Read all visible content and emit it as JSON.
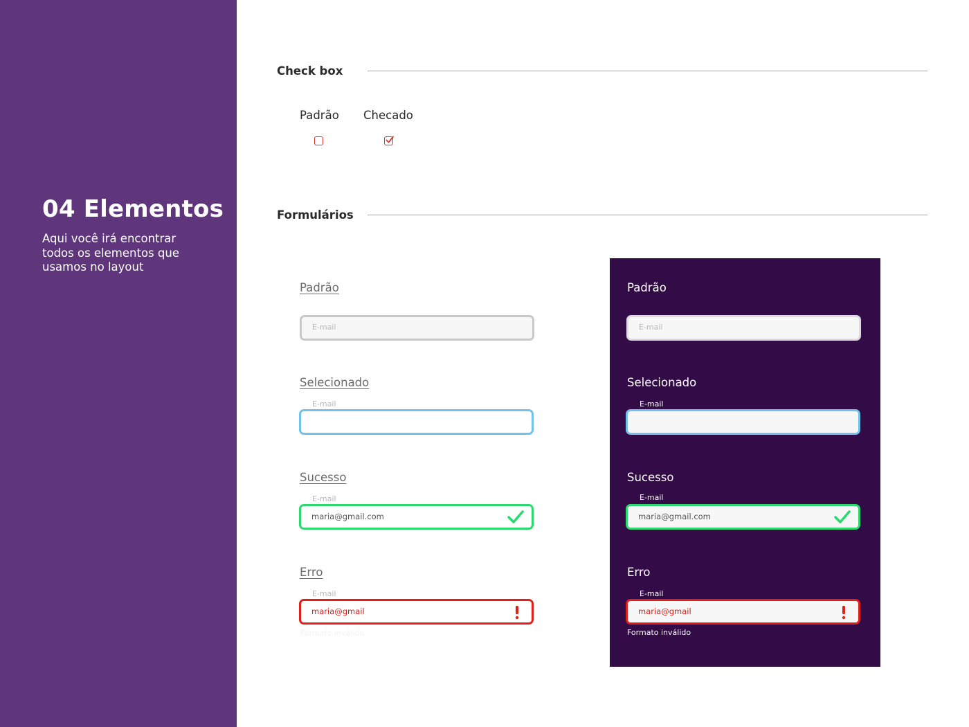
{
  "sidebar": {
    "title": "04 Elementos",
    "description": "Aqui você irá encontrar todos os elementos que usamos no layout"
  },
  "checkbox_section": {
    "title": "Check box",
    "default_label": "Padrão",
    "checked_label": "Checado"
  },
  "forms_section": {
    "title": "Formulários",
    "light": {
      "default": {
        "label": "Padrão",
        "placeholder": "E-mail"
      },
      "selected": {
        "label": "Selecionado",
        "float_label": "E-mail"
      },
      "success": {
        "label": "Sucesso",
        "float_label": "E-mail",
        "value": "maria@gmail.com"
      },
      "error": {
        "label": "Erro",
        "float_label": "E-mail",
        "value": "maria@gmail",
        "helper": "Formato inválido"
      }
    },
    "dark": {
      "default": {
        "label": "Padrão",
        "placeholder": "E-mail"
      },
      "selected": {
        "label": "Selecionado",
        "float_label": "E-mail"
      },
      "success": {
        "label": "Sucesso",
        "float_label": "E-mail",
        "value": "maria@gmail.com"
      },
      "error": {
        "label": "Erro",
        "float_label": "E-mail",
        "value": "maria@gmail",
        "helper": "Formato inválido"
      }
    }
  },
  "colors": {
    "sidebar_bg": "#5f357c",
    "dark_panel_bg": "#330b47",
    "selected": "#6fc3eb",
    "success": "#2bd96f",
    "error": "#e0201b",
    "checkbox": "#e0322f"
  },
  "icons": {
    "success": "check-icon",
    "error": "exclamation-icon",
    "checkbox_checked": "checkmark-icon"
  }
}
